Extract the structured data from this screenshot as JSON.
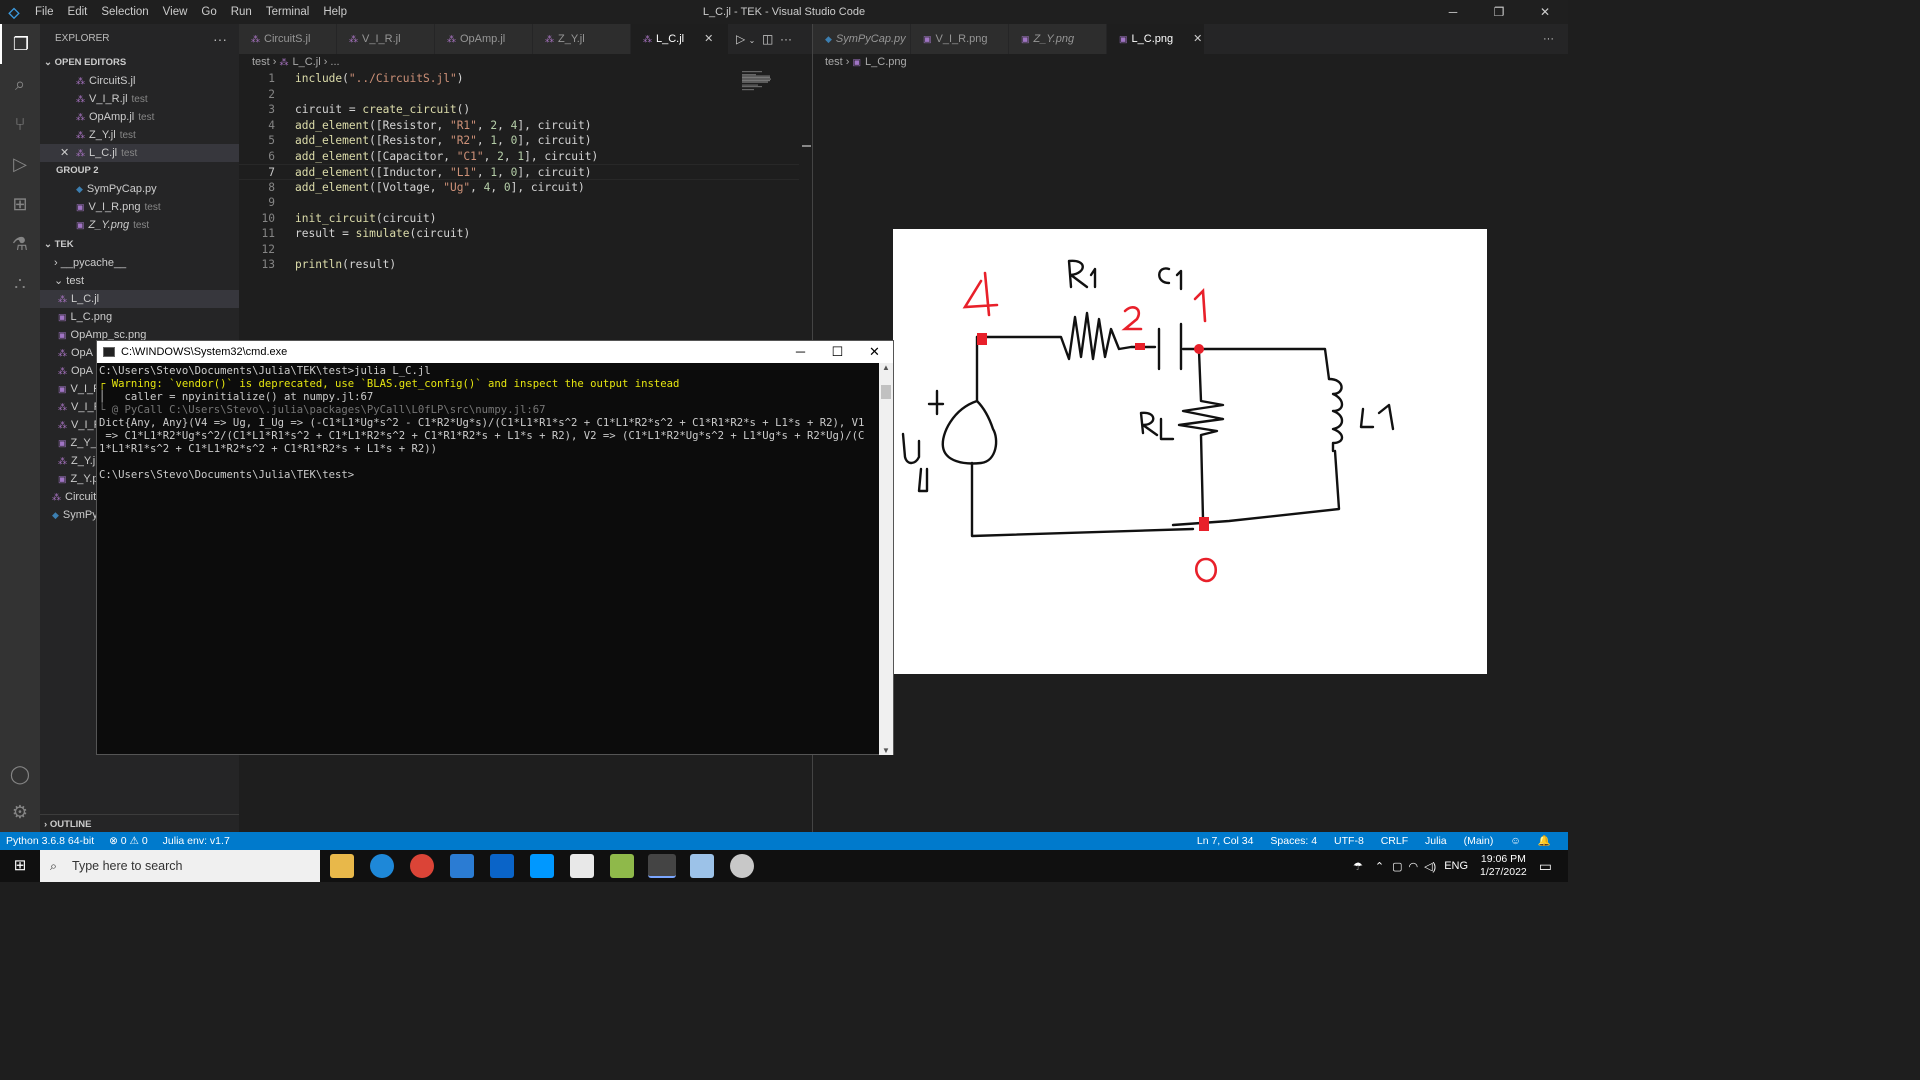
{
  "window": {
    "title": "L_C.jl - TEK - Visual Studio Code",
    "menu": [
      "File",
      "Edit",
      "Selection",
      "View",
      "Go",
      "Run",
      "Terminal",
      "Help"
    ]
  },
  "explorer": {
    "header": "EXPLORER",
    "open_editors_label": "OPEN EDITORS",
    "group2_label": "GROUP 2",
    "open_editors": [
      {
        "name": "CircuitS.jl",
        "desc": ""
      },
      {
        "name": "V_I_R.jl",
        "desc": "test"
      },
      {
        "name": "OpAmp.jl",
        "desc": "test"
      },
      {
        "name": "Z_Y.jl",
        "desc": "test"
      },
      {
        "name": "L_C.jl",
        "desc": "test"
      }
    ],
    "group2": [
      {
        "name": "SymPyCap.py",
        "desc": ""
      },
      {
        "name": "V_I_R.png",
        "desc": "test"
      },
      {
        "name": "Z_Y.png",
        "desc": "test"
      }
    ],
    "folder_label": "TEK",
    "pycache": "__pycache__",
    "test_folder": "test",
    "test_files": [
      "L_C.jl",
      "L_C.png",
      "OpAmp_sc.png",
      "OpA",
      "OpA",
      "V_I_F",
      "V_I_F",
      "V_I_F",
      "Z_Y_",
      "Z_Y.j",
      "Z_Y.p"
    ],
    "root_files": [
      "Circuit",
      "SymPy"
    ],
    "outline_label": "OUTLINE"
  },
  "editor1": {
    "tabs": [
      "CircuitS.jl",
      "V_I_R.jl",
      "OpAmp.jl",
      "Z_Y.jl",
      "L_C.jl"
    ],
    "breadcrumb": [
      "test",
      "L_C.jl",
      "..."
    ],
    "lines": [
      {
        "n": "1",
        "code": "include(\"../CircuitS.jl\")"
      },
      {
        "n": "2",
        "code": ""
      },
      {
        "n": "3",
        "code": "circuit = create_circuit()"
      },
      {
        "n": "4",
        "code": "add_element([Resistor, \"R1\", 2, 4], circuit)"
      },
      {
        "n": "5",
        "code": "add_element([Resistor, \"R2\", 1, 0], circuit)"
      },
      {
        "n": "6",
        "code": "add_element([Capacitor, \"C1\", 2, 1], circuit)"
      },
      {
        "n": "7",
        "code": "add_element([Inductor, \"L1\", 1, 0], circuit)"
      },
      {
        "n": "8",
        "code": "add_element([Voltage, \"Ug\", 4, 0], circuit)"
      },
      {
        "n": "9",
        "code": ""
      },
      {
        "n": "10",
        "code": "init_circuit(circuit)"
      },
      {
        "n": "11",
        "code": "result = simulate(circuit)"
      },
      {
        "n": "12",
        "code": ""
      },
      {
        "n": "13",
        "code": "println(result)"
      }
    ]
  },
  "editor2": {
    "tabs": [
      "SymPyCap.py",
      "V_I_R.png",
      "Z_Y.png",
      "L_C.png"
    ],
    "breadcrumb": [
      "test",
      "L_C.png"
    ],
    "sketch_labels": {
      "node4": "4",
      "node2": "2",
      "node1": "1",
      "node0": "0",
      "r1": "R1",
      "c1": "C1",
      "rl": "RL",
      "l1": "L1",
      "ug": "Ug",
      "plus": "+"
    }
  },
  "cmd": {
    "title": "C:\\WINDOWS\\System32\\cmd.exe",
    "lines": [
      {
        "t": "C:\\Users\\Stevo\\Documents\\Julia\\TEK\\test>julia L_C.jl",
        "c": "plain"
      },
      {
        "t": "┌ Warning: `vendor()` is deprecated, use `BLAS.get_config()` and inspect the output instead",
        "c": "warn"
      },
      {
        "t": "│   caller = npyinitialize() at numpy.jl:67",
        "c": "plain"
      },
      {
        "t": "└ @ PyCall C:\\Users\\Stevo\\.julia\\packages\\PyCall\\L0fLP\\src\\numpy.jl:67",
        "c": "dim"
      },
      {
        "t": "Dict{Any, Any}(V4 => Ug, I_Ug => (-C1*L1*Ug*s^2 - C1*R2*Ug*s)/(C1*L1*R1*s^2 + C1*L1*R2*s^2 + C1*R1*R2*s + L1*s + R2), V1",
        "c": "plain"
      },
      {
        "t": " => C1*L1*R2*Ug*s^2/(C1*L1*R1*s^2 + C1*L1*R2*s^2 + C1*R1*R2*s + L1*s + R2), V2 => (C1*L1*R2*Ug*s^2 + L1*Ug*s + R2*Ug)/(C",
        "c": "plain"
      },
      {
        "t": "1*L1*R1*s^2 + C1*L1*R2*s^2 + C1*R1*R2*s + L1*s + R2))",
        "c": "plain"
      },
      {
        "t": "",
        "c": "plain"
      },
      {
        "t": "C:\\Users\\Stevo\\Documents\\Julia\\TEK\\test>",
        "c": "plain"
      }
    ]
  },
  "status": {
    "python": "Python 3.6.8 64-bit",
    "problems": "⊗ 0 ⚠ 0",
    "julia_env": "Julia env: v1.7",
    "position": "Ln 7, Col 34",
    "spaces": "Spaces: 4",
    "encoding": "UTF-8",
    "eol": "CRLF",
    "language": "Julia",
    "main": "(Main)"
  },
  "taskbar": {
    "search_placeholder": "Type here to search",
    "lang": "ENG",
    "time": "19:06 PM",
    "date": "1/27/2022"
  },
  "colors": {
    "accent": "#007acc",
    "sketch_red": "#e8202a"
  }
}
